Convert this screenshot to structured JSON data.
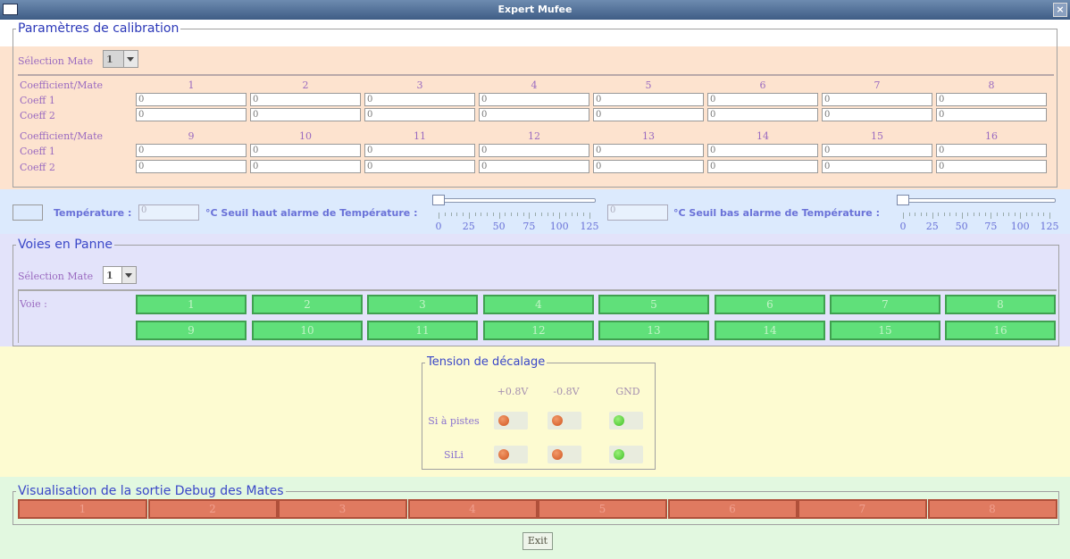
{
  "window": {
    "title": "Expert Mufee",
    "close_glyph": "×"
  },
  "calibration": {
    "legend": "Paramètres de calibration",
    "selection_label": "Sélection Mate",
    "selection_value": "1",
    "header_label": "Coefficient/Mate",
    "coeff1_label": "Coeff 1",
    "coeff2_label": "Coeff 2",
    "columns_top": [
      "1",
      "2",
      "3",
      "4",
      "5",
      "6",
      "7",
      "8"
    ],
    "columns_bottom": [
      "9",
      "10",
      "11",
      "12",
      "13",
      "14",
      "15",
      "16"
    ],
    "coeff1_top": [
      "0",
      "0",
      "0",
      "0",
      "0",
      "0",
      "0",
      "0"
    ],
    "coeff2_top": [
      "0",
      "0",
      "0",
      "0",
      "0",
      "0",
      "0",
      "0"
    ],
    "coeff1_bottom": [
      "0",
      "0",
      "0",
      "0",
      "0",
      "0",
      "0",
      "0"
    ],
    "coeff2_bottom": [
      "0",
      "0",
      "0",
      "0",
      "0",
      "0",
      "0",
      "0"
    ]
  },
  "temperature": {
    "label": "Température :",
    "value": "0",
    "unit_high": "°C  Seuil haut alarme de Température :",
    "high_value": "0",
    "unit_low": "°C  Seuil bas alarme de Température :",
    "slider_high_value": 0,
    "slider_low_value": 0,
    "tick_labels": [
      "0",
      "25",
      "50",
      "75",
      "100",
      "125"
    ]
  },
  "voies": {
    "legend": "Voies en Panne",
    "selection_label": "Sélection Mate",
    "selection_value": "1",
    "voie_label": "Voie :",
    "buttons": [
      "1",
      "2",
      "3",
      "4",
      "5",
      "6",
      "7",
      "8",
      "9",
      "10",
      "11",
      "12",
      "13",
      "14",
      "15",
      "16"
    ],
    "color_ok": "#60e07a"
  },
  "tension": {
    "legend": "Tension de décalage",
    "headers": [
      "+0.8V",
      "-0.8V",
      "GND"
    ],
    "rows": [
      {
        "label": "Si à pistes",
        "states": [
          "orange",
          "orange",
          "green"
        ]
      },
      {
        "label": "SiLi",
        "states": [
          "orange",
          "orange",
          "green"
        ]
      }
    ]
  },
  "debug": {
    "legend": "Visualisation de la sortie Debug des Mates",
    "buttons": [
      "1",
      "2",
      "3",
      "4",
      "5",
      "6",
      "7",
      "8"
    ],
    "color": "#e07a60"
  },
  "exit_label": "Exit"
}
